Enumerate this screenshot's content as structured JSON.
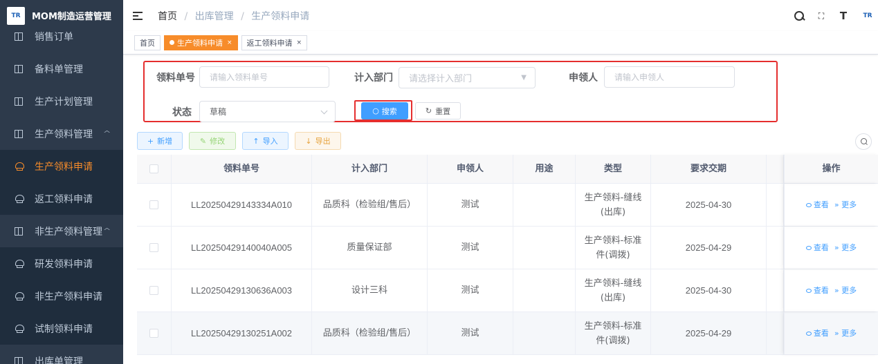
{
  "app": {
    "logo_text": "TR",
    "title": "MOM制造运营管理"
  },
  "sidebar": {
    "items": [
      {
        "label": "销售订单",
        "icon": "book-icon",
        "sub": false,
        "active": false,
        "arrow": ""
      },
      {
        "label": "备料单管理",
        "icon": "book-icon",
        "sub": false,
        "active": false,
        "arrow": ""
      },
      {
        "label": "生产计划管理",
        "icon": "book-icon",
        "sub": false,
        "active": false,
        "arrow": ""
      },
      {
        "label": "生产领料管理",
        "icon": "book-icon",
        "sub": false,
        "active": false,
        "arrow": "^"
      },
      {
        "label": "生产领料申请",
        "icon": "user-icon",
        "sub": true,
        "active": true,
        "arrow": ""
      },
      {
        "label": "返工领料申请",
        "icon": "user-icon",
        "sub": true,
        "active": false,
        "arrow": ""
      },
      {
        "label": "非生产领料管理",
        "icon": "book-icon",
        "sub": false,
        "active": false,
        "arrow": "^"
      },
      {
        "label": "研发领料申请",
        "icon": "user-icon",
        "sub": true,
        "active": false,
        "arrow": ""
      },
      {
        "label": "非生产领料申请",
        "icon": "user-icon",
        "sub": true,
        "active": false,
        "arrow": ""
      },
      {
        "label": "试制领料申请",
        "icon": "user-icon",
        "sub": true,
        "active": false,
        "arrow": ""
      },
      {
        "label": "出库单管理",
        "icon": "book-icon",
        "sub": false,
        "active": false,
        "arrow": ""
      }
    ]
  },
  "header": {
    "breadcrumb": {
      "home": "首页",
      "sep": "/",
      "level1": "出库管理",
      "level2": "生产领料申请"
    },
    "tools": {
      "fullscreen_glyph": "⛶",
      "font_glyph": "T",
      "avatar_text": "TR"
    }
  },
  "tags": [
    {
      "label": "首页",
      "active": false,
      "closable": false
    },
    {
      "label": "生产领料申请",
      "active": true,
      "closable": true
    },
    {
      "label": "返工领料申请",
      "active": false,
      "closable": true
    }
  ],
  "close_glyph": "×",
  "filter": {
    "order_no_label": "领料单号",
    "order_no_placeholder": "请输入领料单号",
    "dept_label": "计入部门",
    "dept_placeholder": "请选择计入部门",
    "applicant_label": "申领人",
    "applicant_placeholder": "请输入申领人",
    "status_label": "状态",
    "status_value": "草稿",
    "search_label": "搜索",
    "reset_label": "重置"
  },
  "toolbar": {
    "add_label": "新增",
    "edit_label": "修改",
    "import_label": "导入",
    "export_label": "导出"
  },
  "table": {
    "columns": [
      "领料单号",
      "计入部门",
      "申领人",
      "用途",
      "类型",
      "要求交期",
      "操作"
    ],
    "rows": [
      {
        "no": "LL20250429143334A010",
        "dept": "品质科（检验组/售后）",
        "applicant": "测试",
        "purpose": "",
        "type": "生产领料-缝线(出库)",
        "type_l1": "生产领料-缝线",
        "type_l2": "(出库)",
        "due": "2025-04-30"
      },
      {
        "no": "LL20250429140040A005",
        "dept": "质量保证部",
        "applicant": "测试",
        "purpose": "",
        "type_l1": "生产领料-标准",
        "type_l2": "件(调拨)",
        "due": "2025-04-29"
      },
      {
        "no": "LL20250429130636A003",
        "dept": "设计三科",
        "applicant": "测试",
        "purpose": "",
        "type_l1": "生产领料-缝线",
        "type_l2": "(出库)",
        "due": "2025-04-30"
      },
      {
        "no": "LL20250429130251A002",
        "dept": "品质科（检验组/售后）",
        "applicant": "测试",
        "purpose": "",
        "type_l1": "生产领料-标准",
        "type_l2": "件(调拨)",
        "due": "2025-04-29"
      }
    ],
    "op_view": "查看",
    "op_more": "更多"
  }
}
